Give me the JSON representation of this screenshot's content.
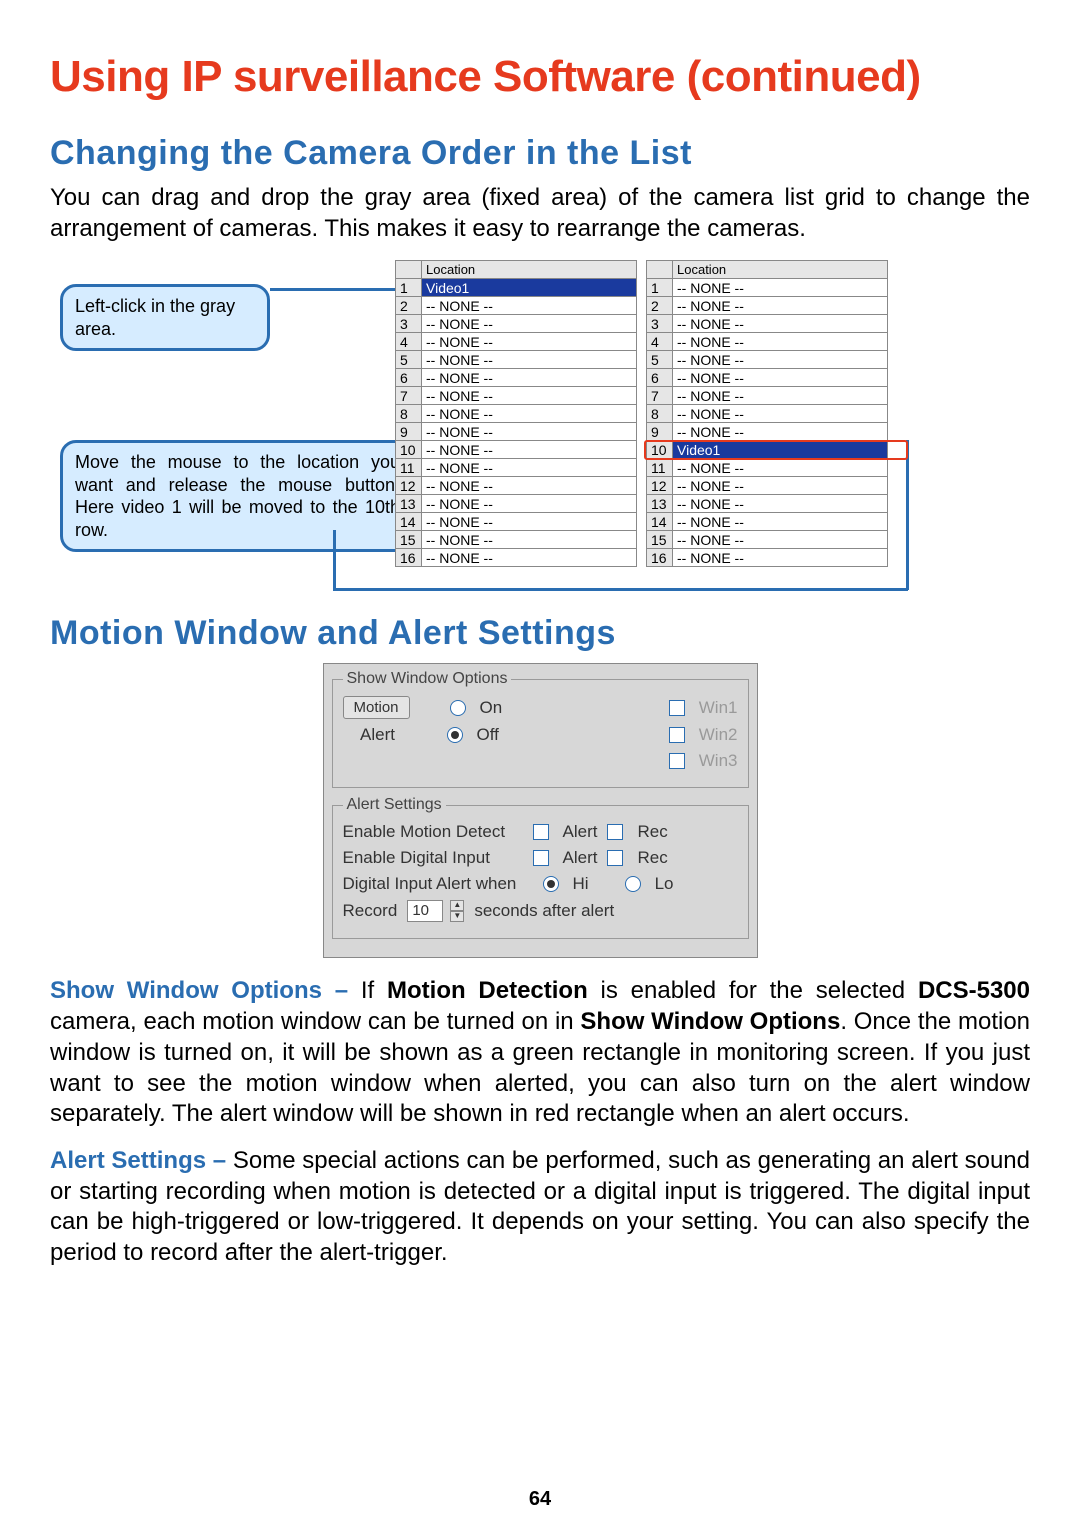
{
  "page_title": "Using IP surveillance Software (continued)",
  "section1": {
    "title": "Changing the Camera Order in the List",
    "body": "You can drag and drop the gray area (fixed area) of the camera list grid to change the arrangement of cameras. This makes it easy to rearrange the cameras."
  },
  "callouts": {
    "c1": "Left-click in the gray area.",
    "c2": "Move the mouse to the location you want and release the  mouse button. Here video 1 will be moved to the 10th row."
  },
  "location_header": "Location",
  "none_label": "-- NONE --",
  "video_label": "Video1",
  "left_table": [
    {
      "idx": "1",
      "val": "Video1",
      "sel": true
    },
    {
      "idx": "2",
      "val": "-- NONE --"
    },
    {
      "idx": "3",
      "val": "-- NONE --"
    },
    {
      "idx": "4",
      "val": "-- NONE --"
    },
    {
      "idx": "5",
      "val": "-- NONE --"
    },
    {
      "idx": "6",
      "val": "-- NONE --"
    },
    {
      "idx": "7",
      "val": "-- NONE --"
    },
    {
      "idx": "8",
      "val": "-- NONE --"
    },
    {
      "idx": "9",
      "val": "-- NONE --"
    },
    {
      "idx": "10",
      "val": "-- NONE --"
    },
    {
      "idx": "11",
      "val": "-- NONE --"
    },
    {
      "idx": "12",
      "val": "-- NONE --"
    },
    {
      "idx": "13",
      "val": "-- NONE --"
    },
    {
      "idx": "14",
      "val": "-- NONE --"
    },
    {
      "idx": "15",
      "val": "-- NONE --"
    },
    {
      "idx": "16",
      "val": "-- NONE --"
    }
  ],
  "right_table": [
    {
      "idx": "1",
      "val": "-- NONE --"
    },
    {
      "idx": "2",
      "val": "-- NONE --"
    },
    {
      "idx": "3",
      "val": "-- NONE --"
    },
    {
      "idx": "4",
      "val": "-- NONE --"
    },
    {
      "idx": "5",
      "val": "-- NONE --"
    },
    {
      "idx": "6",
      "val": "-- NONE --"
    },
    {
      "idx": "7",
      "val": "-- NONE --"
    },
    {
      "idx": "8",
      "val": "-- NONE --"
    },
    {
      "idx": "9",
      "val": "-- NONE --"
    },
    {
      "idx": "10",
      "val": "Video1",
      "sel": true
    },
    {
      "idx": "11",
      "val": "-- NONE --"
    },
    {
      "idx": "12",
      "val": "-- NONE --"
    },
    {
      "idx": "13",
      "val": "-- NONE --"
    },
    {
      "idx": "14",
      "val": "-- NONE --"
    },
    {
      "idx": "15",
      "val": "-- NONE --"
    },
    {
      "idx": "16",
      "val": "-- NONE --"
    }
  ],
  "section2": {
    "title": "Motion Window and Alert Settings"
  },
  "settings": {
    "show_window_legend": "Show Window Options",
    "motion_btn": "Motion",
    "alert_label": "Alert",
    "on_label": "On",
    "off_label": "Off",
    "win1": "Win1",
    "win2": "Win2",
    "win3": "Win3",
    "alert_settings_legend": "Alert Settings",
    "enable_motion_detect": "Enable Motion Detect",
    "enable_digital_input": "Enable Digital Input",
    "digital_input_alert_when": "Digital Input Alert when",
    "alert_chk": "Alert",
    "rec_chk": "Rec",
    "hi": "Hi",
    "lo": "Lo",
    "record_label": "Record",
    "record_value": "10",
    "seconds_after_alert": "seconds after alert"
  },
  "para1": {
    "lead": "Show Window Options – ",
    "t1": "If ",
    "b1": "Motion Detection",
    "t2": " is enabled for the selected ",
    "b2": "DCS-5300",
    "t3": " camera, each motion window can be turned on in ",
    "b3": "Show Window Options",
    "t4": ". Once the motion window is turned on, it will be shown as a green rectangle in monitoring screen. If you just want to see the motion window when alerted, you can also turn on the alert window separately. The alert window will be shown in red rectangle when an alert occurs."
  },
  "para2": {
    "lead": "Alert Settings – ",
    "t1": "Some special actions can be performed, such as generating an alert sound or starting recording when motion is detected or a digital input is triggered. The digital input can be high-triggered or low-triggered. It depends on your setting. You can also specify the period to record after the alert-trigger."
  },
  "page_number": "64"
}
